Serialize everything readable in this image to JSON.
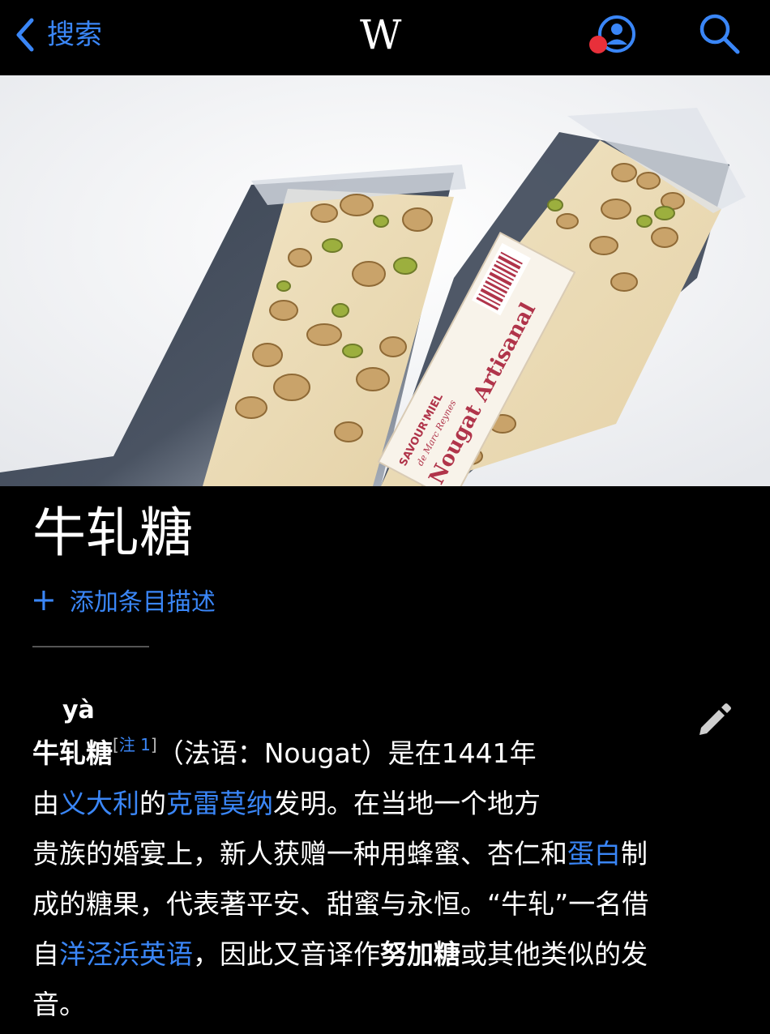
{
  "nav": {
    "back_label": "搜索",
    "logo": "W"
  },
  "article": {
    "title": "牛轧糖",
    "add_description": "添加条目描述",
    "pinyin": "yà",
    "term": "牛轧糖",
    "note_open": "[",
    "note_label": "注 1",
    "note_close": "]",
    "line1_rest": "（法语：Nougat）是在1441年",
    "line2_a": "由",
    "link_italy": "义大利",
    "line2_b": "的",
    "link_cremona": "克雷莫纳",
    "line2_c": "发明。在当地一个地方",
    "line3_a": "贵族的婚宴上，新人获赠一种用蜂蜜、杏仁和",
    "link_egg_white": "蛋白",
    "line3_b": "制",
    "line4": "成的糖果，代表著平安、甜蜜与永恒。“牛轧”一名借",
    "line5_a": "自",
    "link_pidgin": "洋泾浜英语",
    "line5_b": "，因此又音译作",
    "bold_alt": "努加糖",
    "line5_c": "或其他类似的发",
    "line6": "音。"
  },
  "hero_image": {
    "label_brand": "SAVOUR'MIEL",
    "label_sub": "de Marc Reynes",
    "label_product": "Nougat Artisanal"
  },
  "colors": {
    "link": "#3a86f7",
    "background": "#000000",
    "notification_dot": "#e8303a"
  },
  "icons": {
    "back": "chevron-left-icon",
    "account": "account-icon",
    "search": "search-icon",
    "edit": "pencil-icon",
    "add": "plus-icon"
  }
}
